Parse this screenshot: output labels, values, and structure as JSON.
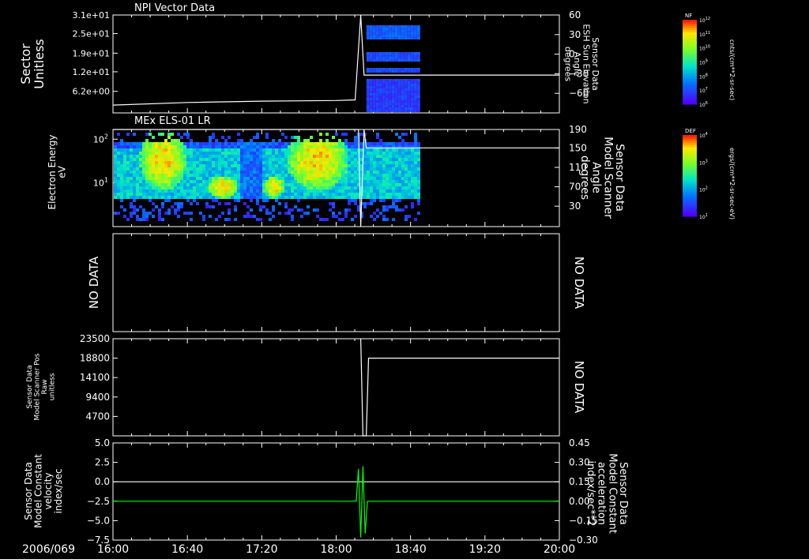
{
  "date_label": "2006/069",
  "time_ticks": [
    "16:00",
    "16:40",
    "17:20",
    "18:00",
    "18:40",
    "19:20",
    "20:00"
  ],
  "no_data_label": "NO DATA",
  "colors": {
    "line": "#ffffff",
    "accel": "#00ff00",
    "background": "#000000"
  },
  "colorbars": [
    {
      "id": "cb1",
      "title": "NF",
      "unit": "cnts/(cm**2-sr-sec)",
      "ticks": [
        "10^12",
        "10^11",
        "10^10",
        "10^9",
        "10^8",
        "10^7",
        "10^6"
      ]
    },
    {
      "id": "cb2",
      "title": "DEF",
      "unit": "ergs/(cm**2-sr-sec-eV)",
      "ticks": [
        "10^4",
        "10^3",
        "10^2",
        "10^1"
      ]
    }
  ],
  "chart_data": [
    {
      "id": "p1",
      "type": "heatmap",
      "title": "NPI Vector Data",
      "ylabel": [
        "Sector",
        "Unitless"
      ],
      "yticks": [
        "3.1e+01",
        "2.5e+01",
        "1.9e+01",
        "1.2e+01",
        "6.2e+00"
      ],
      "right_ylabel": [
        "Sensor Data",
        "ESH Sun Elevation",
        "Angle",
        "degrees"
      ],
      "right_yticks": [
        "60",
        "30",
        "0",
        "−30",
        "−60"
      ],
      "right_ylim": [
        -90,
        60
      ],
      "line": {
        "x": [
          16.0,
          16.67,
          17.33,
          18.0,
          18.17,
          18.22,
          18.25,
          20.0
        ],
        "y": [
          -78,
          -74,
          -72,
          -71,
          -70,
          60,
          -32,
          -32
        ]
      },
      "heatmap_extent_hours": [
        18.25,
        18.75
      ]
    },
    {
      "id": "p2",
      "type": "heatmap",
      "title": "MEx ELS-01 LR",
      "ylabel": [
        "Electron Energy",
        "eV"
      ],
      "yticks": [
        "10^2",
        "10^1"
      ],
      "right_ylabel": [
        "Sensor Data",
        "Model Scanner",
        "Angle",
        "degrees"
      ],
      "right_yticks": [
        "190",
        "150",
        "110",
        "70",
        "30"
      ],
      "right_ylim": [
        5,
        190
      ],
      "line": {
        "x": [
          16.0,
          18.2,
          18.22,
          18.25,
          18.27,
          20.0
        ],
        "y": [
          190,
          190,
          5,
          190,
          155,
          155
        ]
      },
      "heatmap_extent_hours": [
        16.0,
        18.75
      ]
    },
    {
      "id": "p3",
      "type": "line",
      "ylabel": [],
      "no_data": true
    },
    {
      "id": "p4",
      "type": "line",
      "ylabel": [
        "Sensor Data",
        "Model Scanner Pos",
        "Raw",
        "unitless"
      ],
      "yticks": [
        "23500",
        "18800",
        "14100",
        "9400",
        "4700"
      ],
      "ylim": [
        0,
        23500
      ],
      "line": {
        "x": [
          16.0,
          18.22,
          18.24,
          18.27,
          18.29,
          20.0
        ],
        "y": [
          null,
          23500,
          0,
          0,
          18800,
          18800
        ]
      },
      "right_no_data": true
    },
    {
      "id": "p5",
      "type": "line",
      "ylabel": [
        "Sensor Data",
        "Model Constant",
        "velocity",
        "index/sec"
      ],
      "yticks": [
        "5.0",
        "2.5",
        "0.0",
        "−2.5",
        "−5.0",
        "−7.5"
      ],
      "ylim": [
        -7.5,
        5.0
      ],
      "right_ylabel": [
        "Sensor Data",
        "Model Constant",
        "acceleration",
        "index/sec**2"
      ],
      "right_yticks": [
        "0.45",
        "0.30",
        "0.15",
        "0.00",
        "−0.15",
        "−0.30"
      ],
      "right_ylim": [
        -0.3,
        0.45
      ],
      "series": [
        {
          "axis": "left",
          "x": [
            16.0,
            20.0
          ],
          "y": [
            0.0,
            0.0
          ]
        },
        {
          "axis": "right",
          "x": [
            16.0,
            18.18,
            18.2,
            18.22,
            18.24,
            18.26,
            18.28,
            20.0
          ],
          "y": [
            0.0,
            0.0,
            0.25,
            -0.28,
            0.27,
            -0.25,
            0.0,
            0.0
          ]
        }
      ]
    }
  ]
}
